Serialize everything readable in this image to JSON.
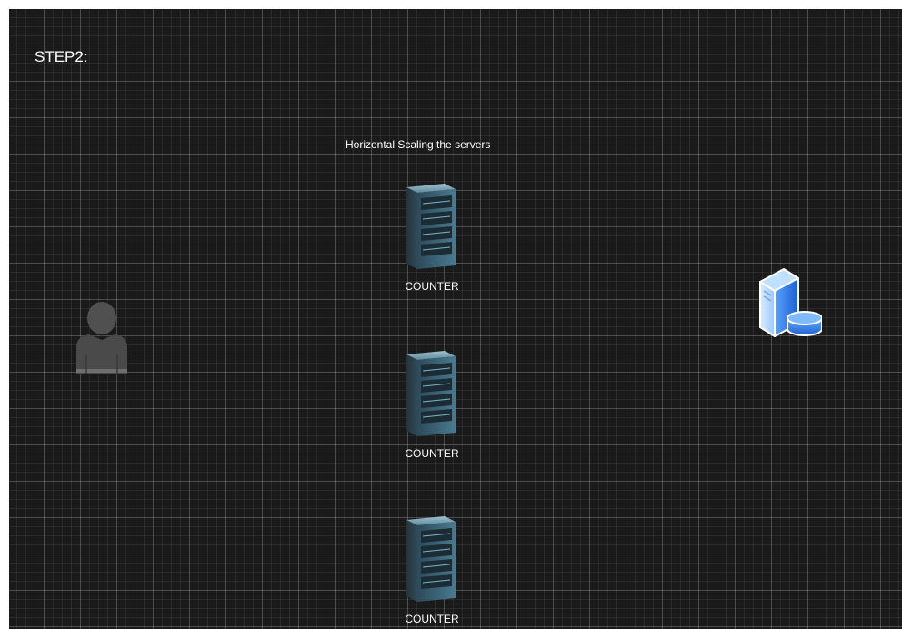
{
  "diagram": {
    "step_title": "STEP2:",
    "heading": "Horizontal Scaling the servers",
    "servers": [
      {
        "label": "COUNTER",
        "icon": "server-rack-icon"
      },
      {
        "label": "COUNTER",
        "icon": "server-rack-icon"
      },
      {
        "label": "COUNTER",
        "icon": "server-rack-icon"
      }
    ],
    "user_icon": "user-icon",
    "database_icon": "database-server-icon",
    "colors": {
      "background": "#1a1a1a",
      "grid": "#3a3a3a",
      "text": "#ffffff",
      "user": "#4f4f4f",
      "database": "#1e6fe0"
    }
  }
}
